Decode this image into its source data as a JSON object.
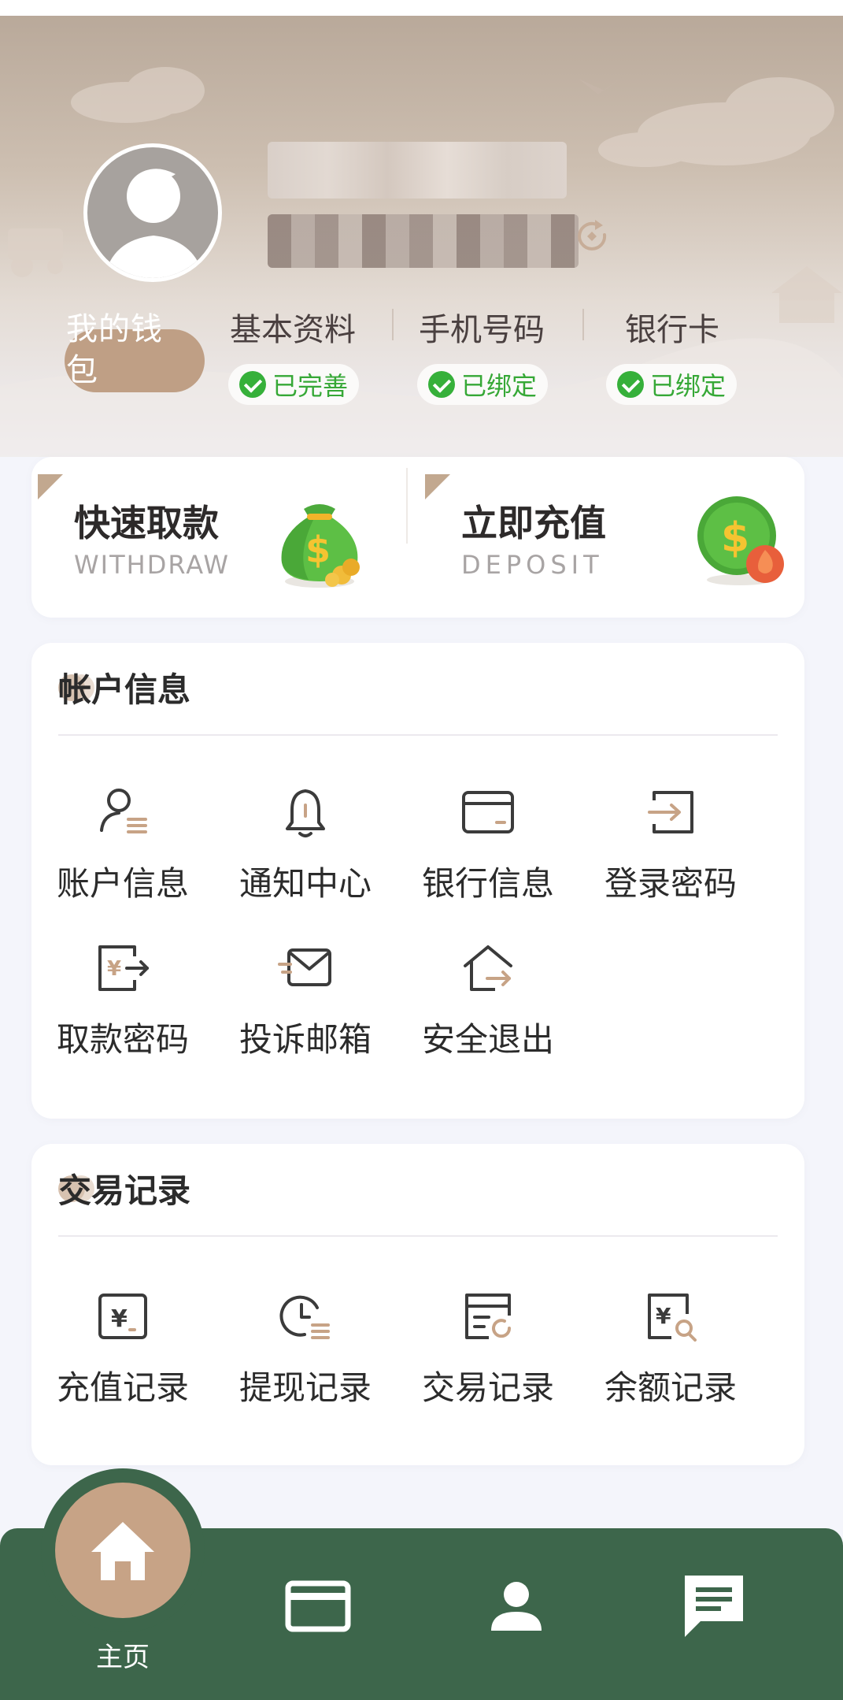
{
  "profile": {
    "wallet_label": "我的钱包"
  },
  "info": [
    {
      "label": "基本资料",
      "status": "已完善"
    },
    {
      "label": "手机号码",
      "status": "已绑定"
    },
    {
      "label": "银行卡",
      "status": "已绑定"
    }
  ],
  "quick": {
    "withdraw": {
      "title": "快速取款",
      "subtitle": "WITHDRAW"
    },
    "deposit": {
      "title": "立即充值",
      "subtitle": "DEPOSIT"
    }
  },
  "account_section": {
    "title": "帐户信息",
    "items": [
      {
        "label": "账户信息",
        "icon": "user-list-icon"
      },
      {
        "label": "通知中心",
        "icon": "bell-icon"
      },
      {
        "label": "银行信息",
        "icon": "card-icon"
      },
      {
        "label": "登录密码",
        "icon": "login-icon"
      },
      {
        "label": "取款密码",
        "icon": "yen-transfer-icon"
      },
      {
        "label": "投诉邮箱",
        "icon": "mail-icon"
      },
      {
        "label": "安全退出",
        "icon": "home-exit-icon"
      }
    ]
  },
  "records_section": {
    "title": "交易记录",
    "items": [
      {
        "label": "充值记录",
        "icon": "yen-receipt-icon"
      },
      {
        "label": "提现记录",
        "icon": "clock-list-icon"
      },
      {
        "label": "交易记录",
        "icon": "doc-refresh-icon"
      },
      {
        "label": "余额记录",
        "icon": "yen-search-icon"
      }
    ]
  },
  "tabbar": {
    "home_label": "主页"
  },
  "colors": {
    "accent_brown": "#c7a386",
    "tabbar_green": "#3d664b",
    "status_green": "#36b03a"
  }
}
